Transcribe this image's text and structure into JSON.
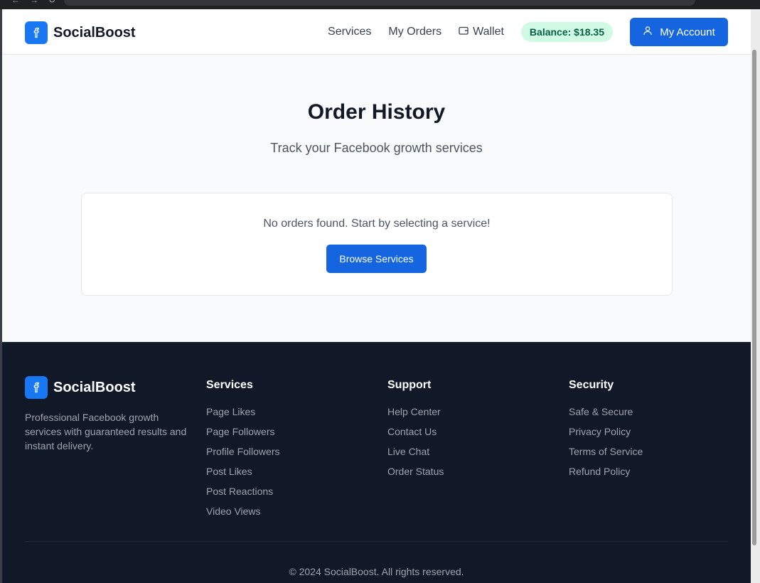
{
  "brand": {
    "name": "SocialBoost"
  },
  "nav": {
    "links": [
      "Services",
      "My Orders",
      "Wallet"
    ],
    "balance": "Balance: $18.35",
    "account_label": "My Account"
  },
  "main": {
    "title": "Order History",
    "subtitle": "Track your Facebook growth services",
    "empty_message": "No orders found. Start by selecting a service!",
    "browse_label": "Browse Services"
  },
  "footer": {
    "description": "Professional Facebook growth services with guaranteed results and instant delivery.",
    "columns": [
      {
        "title": "Services",
        "links": [
          "Page Likes",
          "Page Followers",
          "Profile Followers",
          "Post Likes",
          "Post Reactions",
          "Video Views"
        ]
      },
      {
        "title": "Support",
        "links": [
          "Help Center",
          "Contact Us",
          "Live Chat",
          "Order Status"
        ]
      },
      {
        "title": "Security",
        "links": [
          "Safe & Secure",
          "Privacy Policy",
          "Terms of Service",
          "Refund Policy"
        ]
      }
    ],
    "copyright": "© 2024 SocialBoost. All rights reserved."
  },
  "colors": {
    "brand": "#1877f2",
    "primary": "#1565e0",
    "balance_bg": "#d1fae5",
    "balance_text": "#065f46",
    "footer_bg": "#111827"
  },
  "icons": [
    "facebook-icon",
    "wallet-icon",
    "user-icon"
  ]
}
